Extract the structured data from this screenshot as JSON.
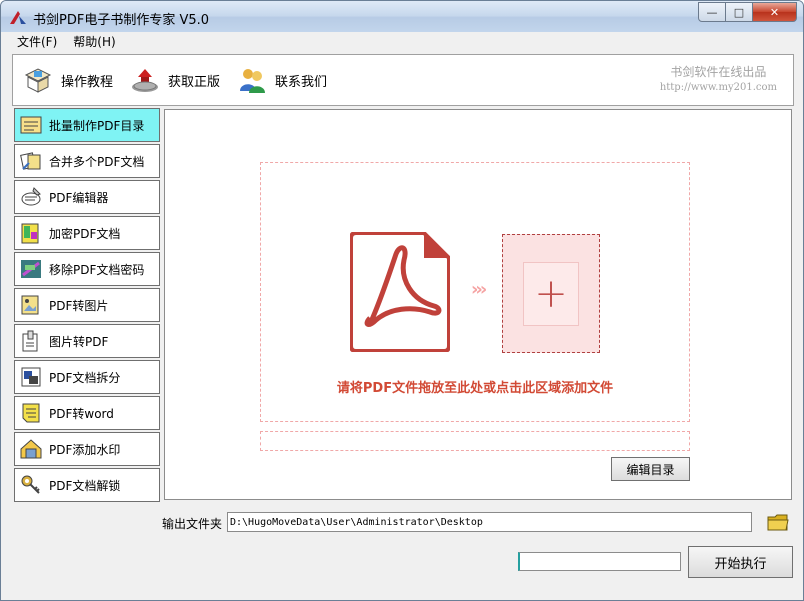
{
  "window": {
    "title": "书剑PDF电子书制作专家 V5.0"
  },
  "menu": [
    {
      "label": "文件(F)"
    },
    {
      "label": "帮助(H)"
    }
  ],
  "toolbar": {
    "buttons": [
      {
        "label": "操作教程",
        "icon": "tutorial-icon"
      },
      {
        "label": "获取正版",
        "icon": "purchase-icon"
      },
      {
        "label": "联系我们",
        "icon": "contact-icon"
      }
    ],
    "brand_name": "书剑软件在线出品",
    "brand_url": "http://www.my201.com"
  },
  "sidebar": {
    "items": [
      {
        "label": "批量制作PDF目录",
        "active": true
      },
      {
        "label": "合并多个PDF文档"
      },
      {
        "label": "PDF编辑器"
      },
      {
        "label": "加密PDF文档"
      },
      {
        "label": "移除PDF文档密码"
      },
      {
        "label": "PDF转图片"
      },
      {
        "label": "图片转PDF"
      },
      {
        "label": "PDF文档拆分"
      },
      {
        "label": "PDF转word"
      },
      {
        "label": "PDF添加水印"
      },
      {
        "label": "PDF文档解锁"
      }
    ]
  },
  "main": {
    "drop_hint": "请将PDF文件拖放至此处或点击此区域添加文件",
    "edit_button": "编辑目录"
  },
  "output": {
    "label": "输出文件夹",
    "path": "D:\\HugoMoveData\\User\\Administrator\\Desktop"
  },
  "progress": {
    "value": 0
  },
  "start_button": "开始执行",
  "colors": {
    "accent": "#d24a35",
    "active_item": "#7ff3f4",
    "pdf_red": "#c0413a"
  }
}
